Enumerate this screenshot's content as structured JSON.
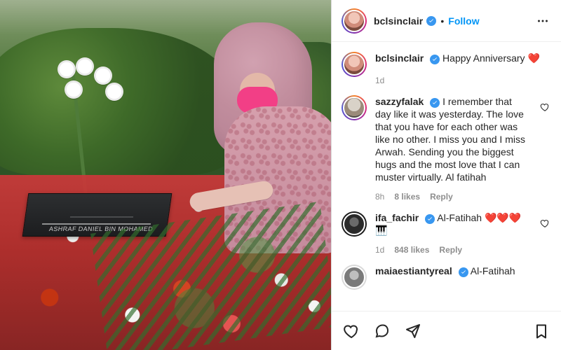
{
  "post": {
    "image": {
      "grave_plate_text": "ASHRAF DANIEL BIN MOHAMED"
    }
  },
  "header": {
    "username": "bclsinclair",
    "separator": "•",
    "follow_label": "Follow"
  },
  "comments": [
    {
      "username": "bclsinclair",
      "text": "Happy Anniversary ❤️",
      "time": "1d"
    },
    {
      "username": "sazzyfalak",
      "text": "I remember that day like it was yesterday. The love that you have for each other was like no other. I miss you and I miss Arwah. Sending you the biggest hugs and the most love that I can muster virtually. Al fatihah",
      "time": "8h",
      "likes": "8 likes",
      "reply_label": "Reply"
    },
    {
      "username": "ifa_fachir",
      "text": "Al-Fatihah ❤️❤️❤️🎹",
      "time": "1d",
      "likes": "848 likes",
      "reply_label": "Reply"
    },
    {
      "username": "maiaestiantyreal",
      "text": "Al-Fatihah"
    }
  ],
  "icons": {
    "verified": "verified-badge-icon",
    "more": "more-options-icon",
    "heart": "heart-icon",
    "comment": "comment-icon",
    "share": "share-icon",
    "save": "bookmark-icon"
  },
  "colors": {
    "follow_blue": "#0095f6",
    "text": "#262626",
    "muted": "#8e8e8e",
    "border": "#dbdbdb",
    "verified": "#3897f0"
  }
}
